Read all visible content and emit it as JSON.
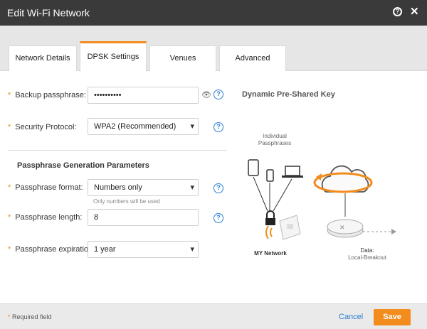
{
  "dialog": {
    "title": "Edit Wi-Fi Network"
  },
  "tabs": [
    {
      "label": "Network Details"
    },
    {
      "label": "DPSK Settings"
    },
    {
      "label": "Venues"
    },
    {
      "label": "Advanced"
    }
  ],
  "form": {
    "backup_passphrase": {
      "label": "Backup passphrase:",
      "value": "••••••••••"
    },
    "security_protocol": {
      "label": "Security Protocol:",
      "value": "WPA2 (Recommended)"
    },
    "section_title": "Passphrase Generation Parameters",
    "passphrase_format": {
      "label": "Passphrase format:",
      "value": "Numbers only",
      "hint": "Only numbers will be used"
    },
    "passphrase_length": {
      "label": "Passphrase length:",
      "value": "8"
    },
    "passphrase_expiration": {
      "label": "Passphrase expiration:",
      "value": "1 year"
    }
  },
  "diagram": {
    "title": "Dynamic Pre-Shared Key",
    "individual_label_1": "Individual",
    "individual_label_2": "Passphrases",
    "network_label": "MY Network",
    "data_label_1": "Data:",
    "data_label_2": "Local-Breakout"
  },
  "footer": {
    "required_label": "Required field",
    "cancel_label": "Cancel",
    "save_label": "Save"
  },
  "colors": {
    "accent": "#f28c1c",
    "link": "#2a7fd4",
    "titlebar": "#3a3a3a"
  }
}
